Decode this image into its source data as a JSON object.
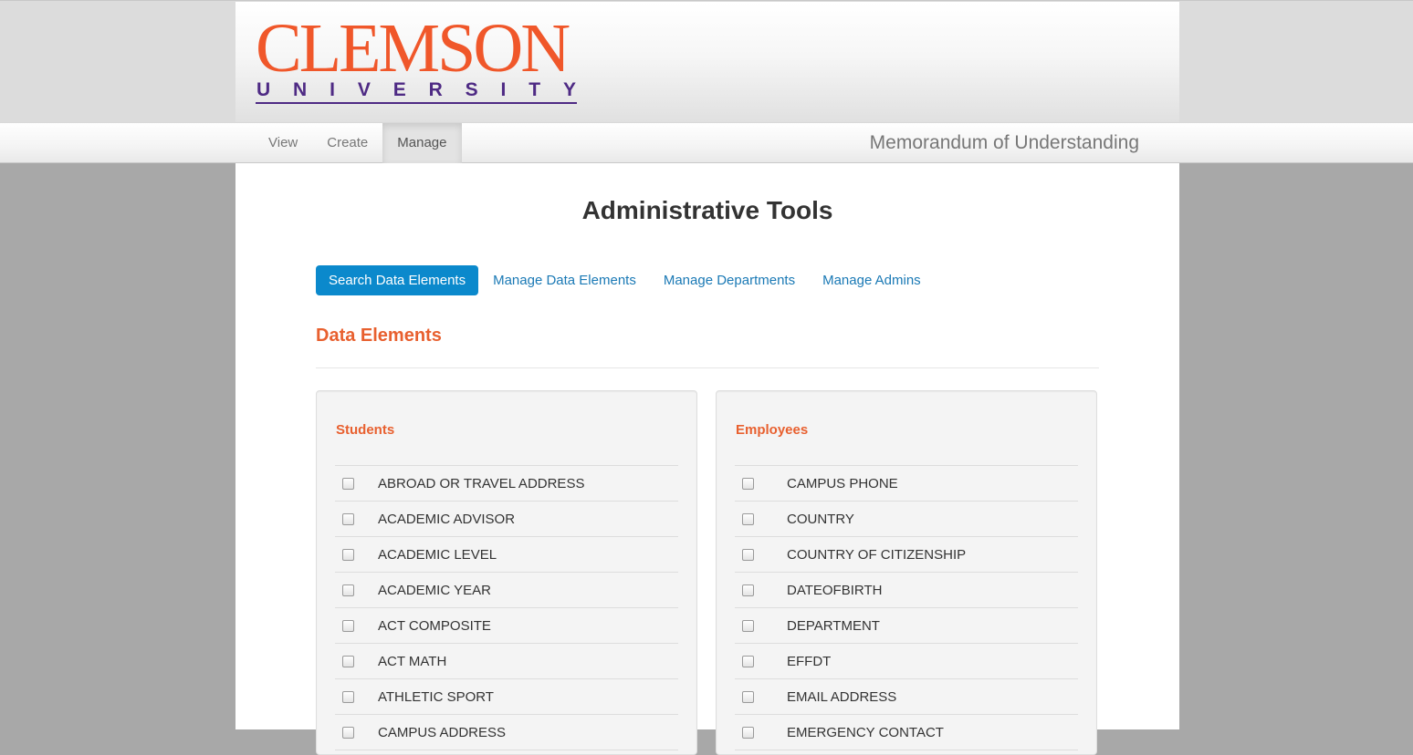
{
  "header": {
    "logo": {
      "word": "CLEMSON",
      "sub": [
        "U",
        "N",
        "I",
        "V",
        "E",
        "R",
        "S",
        "I",
        "T",
        "Y"
      ]
    }
  },
  "nav": {
    "items": [
      {
        "label": "View",
        "active": false
      },
      {
        "label": "Create",
        "active": false
      },
      {
        "label": "Manage",
        "active": true
      }
    ],
    "brand": "Memorandum of Understanding"
  },
  "main": {
    "title": "Administrative Tools",
    "tabs": [
      {
        "label": "Search Data Elements",
        "active": true
      },
      {
        "label": "Manage Data Elements",
        "active": false
      },
      {
        "label": "Manage Departments",
        "active": false
      },
      {
        "label": "Manage Admins",
        "active": false
      }
    ],
    "section_title": "Data Elements",
    "panels": [
      {
        "heading": "Students",
        "items": [
          "ABROAD OR TRAVEL ADDRESS",
          "ACADEMIC ADVISOR",
          "ACADEMIC LEVEL",
          "ACADEMIC YEAR",
          "ACT COMPOSITE",
          "ACT MATH",
          "ATHLETIC SPORT",
          "CAMPUS ADDRESS"
        ]
      },
      {
        "heading": "Employees",
        "items": [
          "CAMPUS PHONE",
          "COUNTRY",
          "COUNTRY OF CITIZENSHIP",
          "DATEOFBIRTH",
          "DEPARTMENT",
          "EFFDT",
          "EMAIL ADDRESS",
          "EMERGENCY CONTACT"
        ]
      }
    ]
  },
  "colors": {
    "clemson_orange": "#f0572a",
    "clemson_purple": "#4e2a84",
    "pill_active": "#0b89cc",
    "link": "#1a79b5",
    "section_orange": "#e8602f"
  }
}
